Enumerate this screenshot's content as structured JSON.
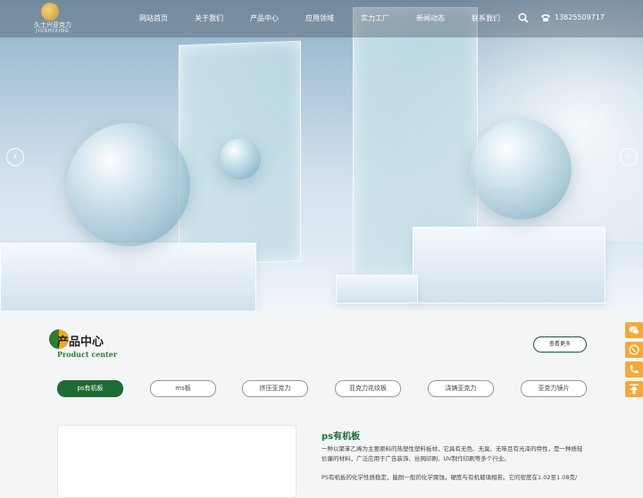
{
  "header": {
    "logo": {
      "name": "久士兴亚克力",
      "pinyin": "JIUSHIXING"
    },
    "nav": [
      "网站首页",
      "关于我们",
      "产品中心",
      "应用领域",
      "实力工厂",
      "新闻动态",
      "联系我们"
    ],
    "phone": "13825509717"
  },
  "hero": {
    "prev_icon": "chevron-left-icon",
    "next_icon": "chevron-right-icon"
  },
  "section": {
    "title": "产品中心",
    "subtitle": "Product center",
    "more_label": "查看更多"
  },
  "tabs": [
    "ps有机板",
    "ms板",
    "挤压亚克力",
    "亚克力花纹板",
    "浇铸亚克力",
    "亚克力镜片"
  ],
  "active_tab": 0,
  "product": {
    "title": "ps有机板",
    "description": "一种以聚苯乙烯为主要原料的热塑性塑料板材，它具有无色、无臭、无味且有光泽的特性，是一种质轻价廉的材料，广泛应用于广告装饰、丝网印刷、UV制作印刷等多个行业。",
    "description2": "PS有机板的化学性质稳定，能耐一般的化学腐蚀，硬度与有机玻璃相若。它的密度在1.02至1.08克/"
  },
  "sidebar": [
    "wechat-icon",
    "chat-icon",
    "phone-icon",
    "back-to-top-icon"
  ],
  "colors": {
    "brand": "#1f6b34",
    "accent": "#f2a93b"
  }
}
